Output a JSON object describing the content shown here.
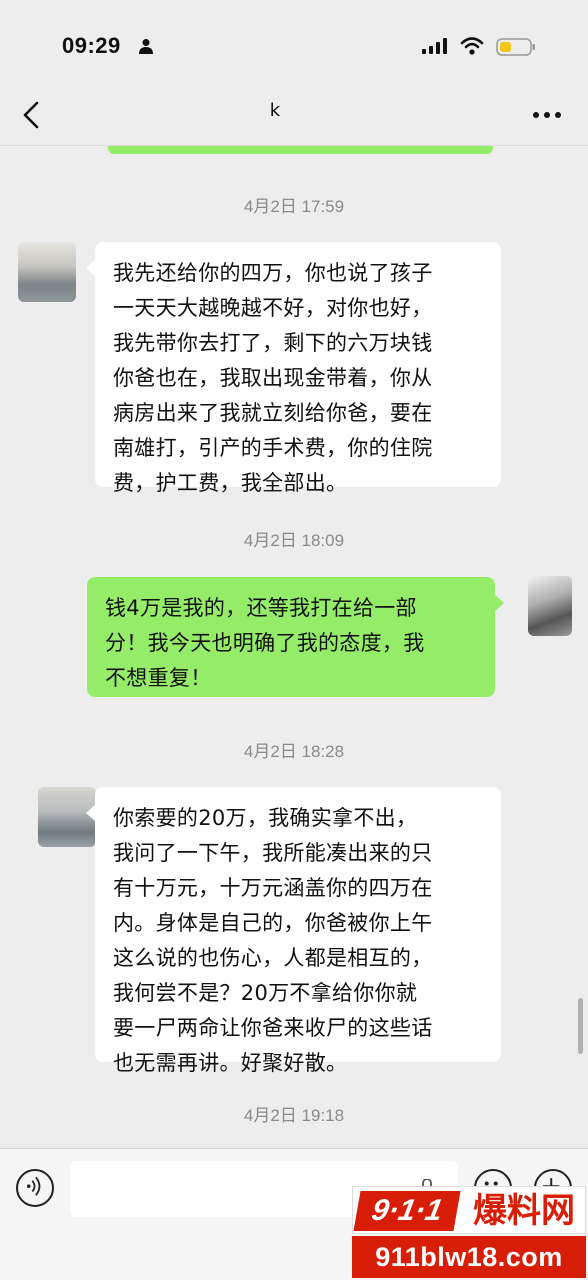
{
  "status_bar": {
    "time": "09:29",
    "icons": [
      "person-icon",
      "signal-icon",
      "wifi-icon",
      "battery-icon"
    ],
    "battery_color": "#f5c518"
  },
  "header": {
    "title": "k",
    "back_icon": "chevron-left-icon",
    "more_icon": "more-dots-icon"
  },
  "messages": [
    {
      "timestamp": "4月2日 17:59",
      "side": "left",
      "lines": [
        "我先还给你的四万，你也说了孩子",
        "一天天大越晚越不好，对你也好，",
        "我先带你去打了，剩下的六万块钱",
        "你爸也在，我取出现金带着，你从",
        "病房出来了我就立刻给你爸，要在",
        "南雄打，引产的手术费，你的住院",
        "费，护工费，我全部出。"
      ]
    },
    {
      "timestamp": "4月2日 18:09",
      "side": "right",
      "lines": [
        "钱4万是我的，还等我打在给一部",
        "分！我今天也明确了我的态度，我",
        "不想重复！"
      ]
    },
    {
      "timestamp": "4月2日 18:28",
      "side": "left",
      "lines": [
        "你索要的20万，我确实拿不出，",
        "我问了一下午，我所能凑出来的只",
        "有十万元，十万元涵盖你的四万在",
        "内。身体是自己的，你爸被你上午",
        "这么说的也伤心，人都是相互的，",
        "我何尝不是？20万不拿给你你就",
        "要一尸两命让你爸来收尸的这些话",
        "也无需再讲。好聚好散。"
      ]
    }
  ],
  "last_timestamp": "4月2日 19:18",
  "input_bar": {
    "icons": [
      "voice-icon",
      "microphone-icon",
      "emoji-icon",
      "plus-icon"
    ]
  },
  "watermark": {
    "badge": "9·1·1",
    "brand": "爆料网",
    "url": "911blw18.com"
  },
  "colors": {
    "outgoing_bubble": "#95ec69",
    "incoming_bubble": "#ffffff",
    "background": "#ededed",
    "watermark_red": "#d81e06"
  }
}
